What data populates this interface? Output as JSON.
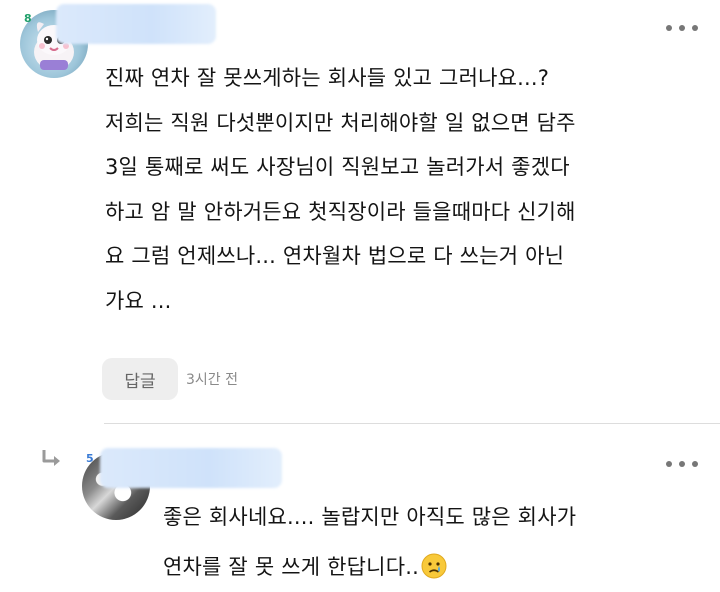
{
  "comment1": {
    "level_badge": "8",
    "username": "",
    "lines": [
      "진짜 연차 잘 못쓰게하는 회사들 있고 그러나요...?",
      "저희는 직원 다섯뿐이지만 처리해야할 일 없으면 담주",
      "3일 통째로 써도 사장님이 직원보고 놀러가서 좋겠다",
      "하고 암 말 안하거든요 첫직장이라 들을때마다 신기해",
      "요 그럼 언제쓰나... 연차월차 법으로 다 쓰는거 아닌",
      "가요 ..."
    ],
    "reply_label": "답글",
    "time": "3시간 전"
  },
  "comment2": {
    "level_badge": "5",
    "username": "",
    "lines": [
      "좋은 회사네요.... 놀랍지만 아직도 많은 회사가",
      "연차를 잘 못 쓰게 한답니다.."
    ],
    "emoji": "crying-face-emoji"
  },
  "colors": {
    "text": "#141414",
    "muted": "#8a8a8a",
    "reply_button_bg": "#eeeeee",
    "divider": "#dddddd",
    "name_blur": "#cfe2fa"
  }
}
